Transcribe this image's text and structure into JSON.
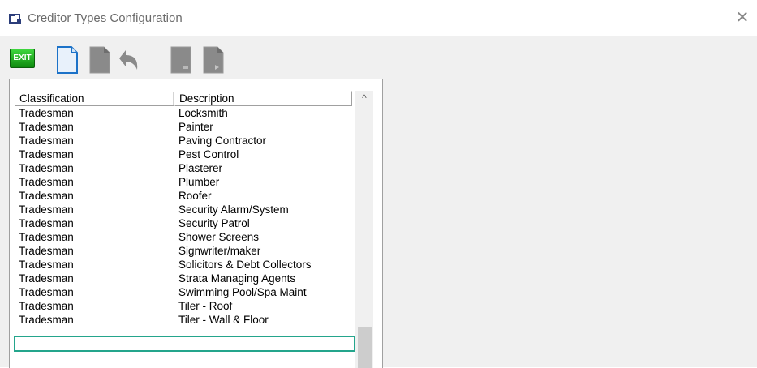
{
  "window": {
    "title": "Creditor Types Configuration",
    "close_label": "✕"
  },
  "toolbar": {
    "exit_label": "EXIT",
    "buttons": [
      "new-icon",
      "save-icon",
      "undo-icon",
      "delete-icon",
      "export-icon"
    ]
  },
  "list": {
    "columns": [
      "Classification",
      "Description"
    ],
    "rows": [
      {
        "classification": "Tradesman",
        "description": "Locksmith"
      },
      {
        "classification": "Tradesman",
        "description": "Painter"
      },
      {
        "classification": "Tradesman",
        "description": "Paving Contractor"
      },
      {
        "classification": "Tradesman",
        "description": "Pest Control"
      },
      {
        "classification": "Tradesman",
        "description": "Plasterer"
      },
      {
        "classification": "Tradesman",
        "description": "Plumber"
      },
      {
        "classification": "Tradesman",
        "description": "Roofer"
      },
      {
        "classification": "Tradesman",
        "description": "Security Alarm/System"
      },
      {
        "classification": "Tradesman",
        "description": "Security Patrol"
      },
      {
        "classification": "Tradesman",
        "description": "Shower Screens"
      },
      {
        "classification": "Tradesman",
        "description": "Signwriter/maker"
      },
      {
        "classification": "Tradesman",
        "description": "Solicitors & Debt Collectors"
      },
      {
        "classification": "Tradesman",
        "description": "Strata Managing Agents"
      },
      {
        "classification": "Tradesman",
        "description": "Swimming Pool/Spa Maint"
      },
      {
        "classification": "Tradesman",
        "description": "Tiler - Roof"
      },
      {
        "classification": "Tradesman",
        "description": "Tiler - Wall & Floor"
      }
    ],
    "highlighted_row": 14,
    "highlight_color": "#24a58c"
  },
  "scrollbar": {
    "up_arrow": "^"
  }
}
